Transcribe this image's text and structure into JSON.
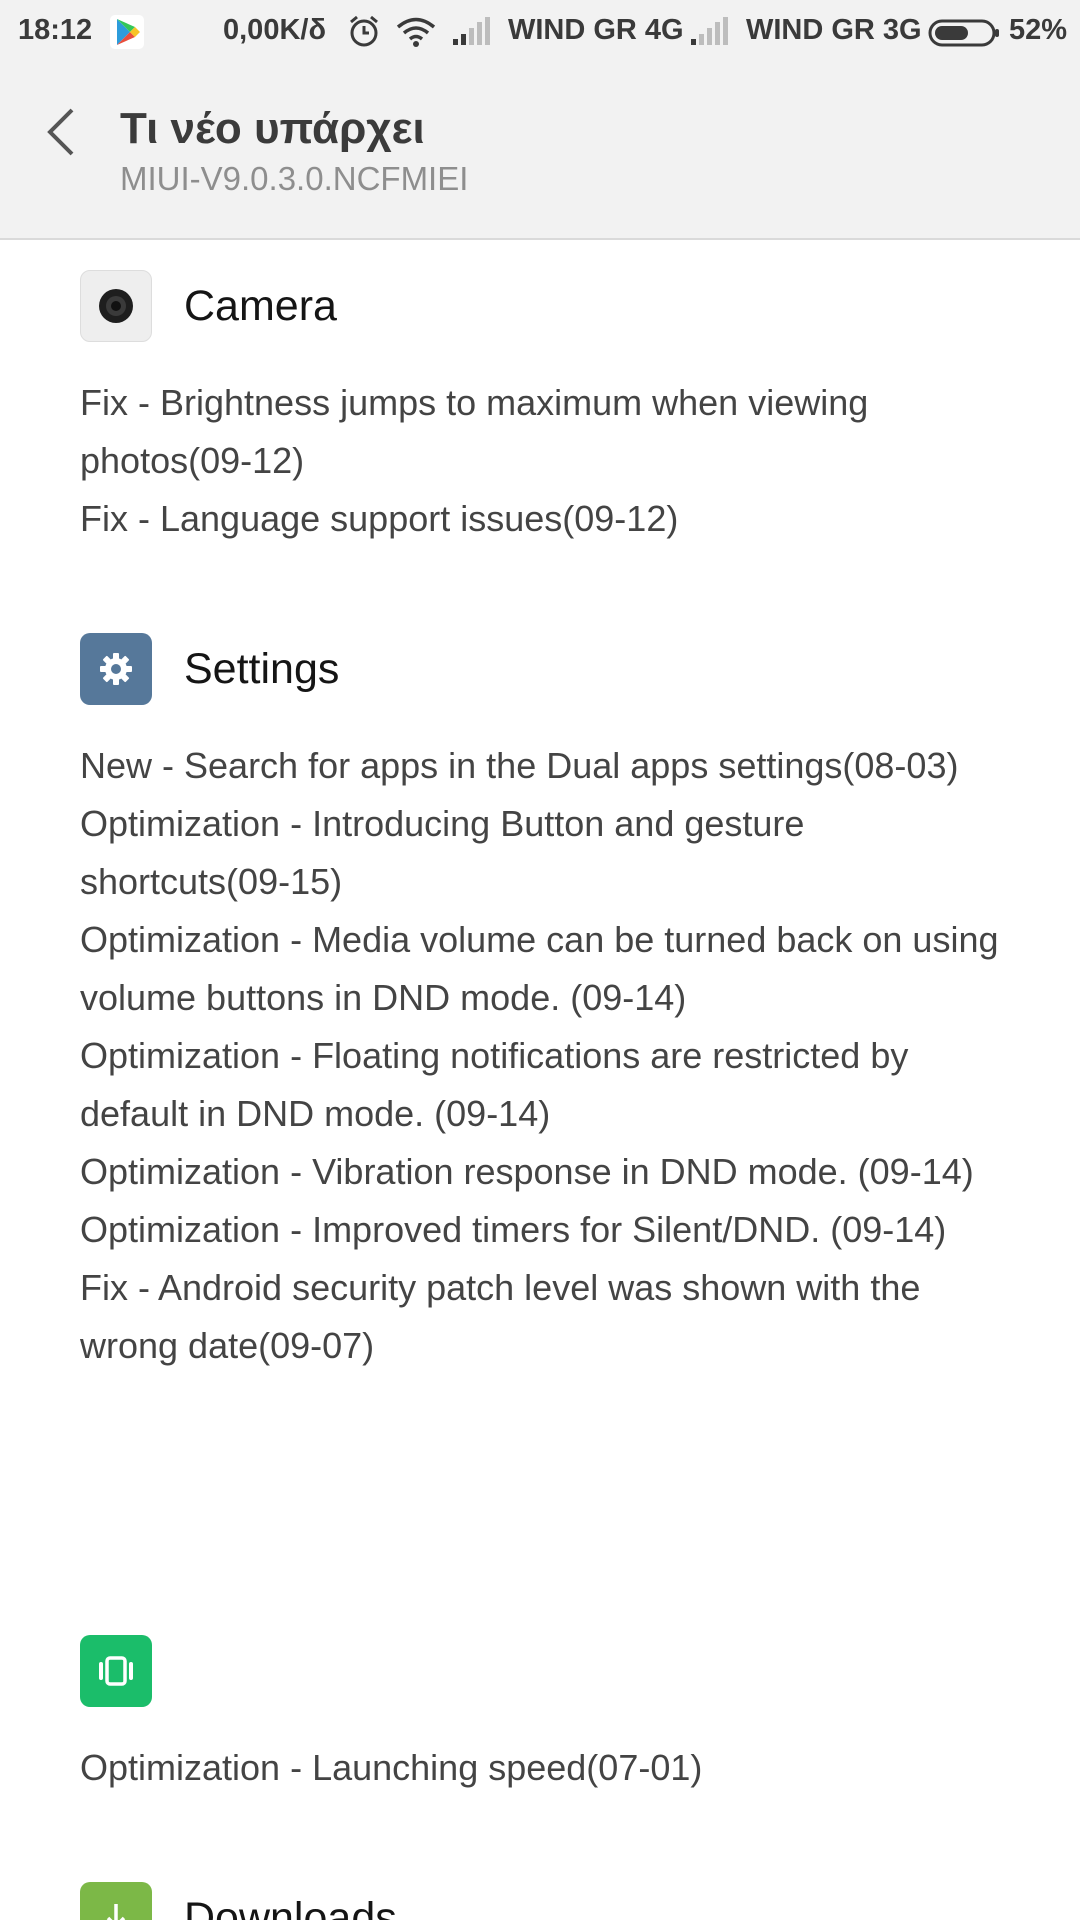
{
  "status_bar": {
    "time": "18:12",
    "speed": "0,00K/δ",
    "carrier1": "WIND GR 4G",
    "carrier2": "WIND GR 3G",
    "battery": "52%",
    "icons": [
      "play-store-icon",
      "alarm-icon",
      "wifi-icon",
      "signal-icon",
      "battery-icon"
    ]
  },
  "header": {
    "title": "Τι νέο υπάρχει",
    "subtitle": "MIUI-V9.0.3.0.NCFMIEI"
  },
  "sections": [
    {
      "name": "Camera",
      "icon": "camera-icon",
      "icon_bg": "#eeeeee",
      "notes": [
        "Fix - Brightness jumps to maximum when viewing photos(09-12)",
        "Fix - Language support issues(09-12)"
      ]
    },
    {
      "name": "Settings",
      "icon": "gear-icon",
      "icon_bg": "#56789a",
      "notes": [
        "New - Search for apps in the Dual apps settings(08-03)",
        "Optimization - Introducing Button and gesture shortcuts(09-15)",
        "Optimization - Media volume can be turned back on using volume buttons in DND mode. (09-14)",
        "Optimization - Floating notifications are restricted by default in DND mode. (09-14)",
        "Optimization - Vibration response in DND mode. (09-14)",
        "Optimization - Improved timers for Silent/DND. (09-14)",
        "Fix - Android security patch level was shown with the wrong date(09-07)"
      ]
    },
    {
      "name": "",
      "icon": "app-vault-icon",
      "icon_bg": "#1bbd6a",
      "notes": [
        "Optimization - Launching speed(07-01)"
      ]
    },
    {
      "name": "Downloads",
      "icon": "download-icon",
      "icon_bg": "#7cb847",
      "notes": []
    }
  ]
}
